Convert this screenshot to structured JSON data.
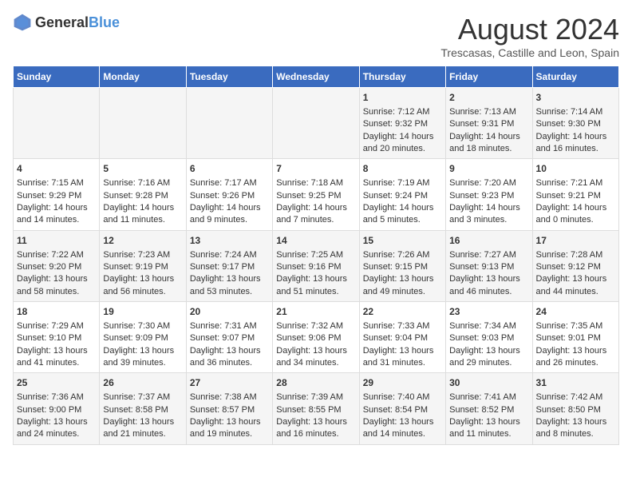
{
  "header": {
    "logo_general": "General",
    "logo_blue": "Blue",
    "title": "August 2024",
    "subtitle": "Trescasas, Castille and Leon, Spain"
  },
  "days_of_week": [
    "Sunday",
    "Monday",
    "Tuesday",
    "Wednesday",
    "Thursday",
    "Friday",
    "Saturday"
  ],
  "weeks": [
    [
      {
        "day": "",
        "content": ""
      },
      {
        "day": "",
        "content": ""
      },
      {
        "day": "",
        "content": ""
      },
      {
        "day": "",
        "content": ""
      },
      {
        "day": "1",
        "content": "Sunrise: 7:12 AM\nSunset: 9:32 PM\nDaylight: 14 hours and 20 minutes."
      },
      {
        "day": "2",
        "content": "Sunrise: 7:13 AM\nSunset: 9:31 PM\nDaylight: 14 hours and 18 minutes."
      },
      {
        "day": "3",
        "content": "Sunrise: 7:14 AM\nSunset: 9:30 PM\nDaylight: 14 hours and 16 minutes."
      }
    ],
    [
      {
        "day": "4",
        "content": "Sunrise: 7:15 AM\nSunset: 9:29 PM\nDaylight: 14 hours and 14 minutes."
      },
      {
        "day": "5",
        "content": "Sunrise: 7:16 AM\nSunset: 9:28 PM\nDaylight: 14 hours and 11 minutes."
      },
      {
        "day": "6",
        "content": "Sunrise: 7:17 AM\nSunset: 9:26 PM\nDaylight: 14 hours and 9 minutes."
      },
      {
        "day": "7",
        "content": "Sunrise: 7:18 AM\nSunset: 9:25 PM\nDaylight: 14 hours and 7 minutes."
      },
      {
        "day": "8",
        "content": "Sunrise: 7:19 AM\nSunset: 9:24 PM\nDaylight: 14 hours and 5 minutes."
      },
      {
        "day": "9",
        "content": "Sunrise: 7:20 AM\nSunset: 9:23 PM\nDaylight: 14 hours and 3 minutes."
      },
      {
        "day": "10",
        "content": "Sunrise: 7:21 AM\nSunset: 9:21 PM\nDaylight: 14 hours and 0 minutes."
      }
    ],
    [
      {
        "day": "11",
        "content": "Sunrise: 7:22 AM\nSunset: 9:20 PM\nDaylight: 13 hours and 58 minutes."
      },
      {
        "day": "12",
        "content": "Sunrise: 7:23 AM\nSunset: 9:19 PM\nDaylight: 13 hours and 56 minutes."
      },
      {
        "day": "13",
        "content": "Sunrise: 7:24 AM\nSunset: 9:17 PM\nDaylight: 13 hours and 53 minutes."
      },
      {
        "day": "14",
        "content": "Sunrise: 7:25 AM\nSunset: 9:16 PM\nDaylight: 13 hours and 51 minutes."
      },
      {
        "day": "15",
        "content": "Sunrise: 7:26 AM\nSunset: 9:15 PM\nDaylight: 13 hours and 49 minutes."
      },
      {
        "day": "16",
        "content": "Sunrise: 7:27 AM\nSunset: 9:13 PM\nDaylight: 13 hours and 46 minutes."
      },
      {
        "day": "17",
        "content": "Sunrise: 7:28 AM\nSunset: 9:12 PM\nDaylight: 13 hours and 44 minutes."
      }
    ],
    [
      {
        "day": "18",
        "content": "Sunrise: 7:29 AM\nSunset: 9:10 PM\nDaylight: 13 hours and 41 minutes."
      },
      {
        "day": "19",
        "content": "Sunrise: 7:30 AM\nSunset: 9:09 PM\nDaylight: 13 hours and 39 minutes."
      },
      {
        "day": "20",
        "content": "Sunrise: 7:31 AM\nSunset: 9:07 PM\nDaylight: 13 hours and 36 minutes."
      },
      {
        "day": "21",
        "content": "Sunrise: 7:32 AM\nSunset: 9:06 PM\nDaylight: 13 hours and 34 minutes."
      },
      {
        "day": "22",
        "content": "Sunrise: 7:33 AM\nSunset: 9:04 PM\nDaylight: 13 hours and 31 minutes."
      },
      {
        "day": "23",
        "content": "Sunrise: 7:34 AM\nSunset: 9:03 PM\nDaylight: 13 hours and 29 minutes."
      },
      {
        "day": "24",
        "content": "Sunrise: 7:35 AM\nSunset: 9:01 PM\nDaylight: 13 hours and 26 minutes."
      }
    ],
    [
      {
        "day": "25",
        "content": "Sunrise: 7:36 AM\nSunset: 9:00 PM\nDaylight: 13 hours and 24 minutes."
      },
      {
        "day": "26",
        "content": "Sunrise: 7:37 AM\nSunset: 8:58 PM\nDaylight: 13 hours and 21 minutes."
      },
      {
        "day": "27",
        "content": "Sunrise: 7:38 AM\nSunset: 8:57 PM\nDaylight: 13 hours and 19 minutes."
      },
      {
        "day": "28",
        "content": "Sunrise: 7:39 AM\nSunset: 8:55 PM\nDaylight: 13 hours and 16 minutes."
      },
      {
        "day": "29",
        "content": "Sunrise: 7:40 AM\nSunset: 8:54 PM\nDaylight: 13 hours and 14 minutes."
      },
      {
        "day": "30",
        "content": "Sunrise: 7:41 AM\nSunset: 8:52 PM\nDaylight: 13 hours and 11 minutes."
      },
      {
        "day": "31",
        "content": "Sunrise: 7:42 AM\nSunset: 8:50 PM\nDaylight: 13 hours and 8 minutes."
      }
    ]
  ]
}
